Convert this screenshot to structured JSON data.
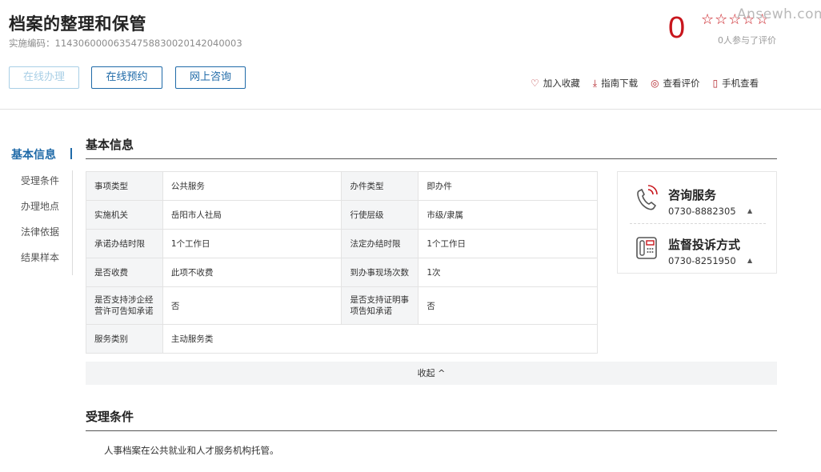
{
  "header": {
    "title": "档案的整理和保管",
    "code_label": "实施编码：",
    "code_value": "11430600006354758830020142040003",
    "buttons": [
      "在线办理",
      "在线预约",
      "网上咨询"
    ],
    "score": "0",
    "stars": "☆☆☆☆☆",
    "rating_count": "0人参与了评价",
    "watermark": "Ansewh.com",
    "actions": [
      {
        "icon": "heart-icon",
        "label": "加入收藏"
      },
      {
        "icon": "download-icon",
        "label": "指南下载"
      },
      {
        "icon": "review-icon",
        "label": "查看评价"
      },
      {
        "icon": "mobile-icon",
        "label": "手机查看"
      }
    ]
  },
  "sidenav": {
    "items": [
      "基本信息",
      "受理条件",
      "办理地点",
      "法律依据",
      "结果样本"
    ],
    "active_index": 0
  },
  "basic_info": {
    "heading": "基本信息",
    "rows": [
      [
        "事项类型",
        "公共服务",
        "办件类型",
        "即办件"
      ],
      [
        "实施机关",
        "岳阳市人社局",
        "行使层级",
        "市级/隶属"
      ],
      [
        "承诺办结时限",
        "1个工作日",
        "法定办结时限",
        "1个工作日"
      ],
      [
        "是否收费",
        "此项不收费",
        "到办事现场次数",
        "1次"
      ],
      [
        "是否支持涉企经营许可告知承诺",
        "否",
        "是否支持证明事项告知承诺",
        "否"
      ],
      [
        "服务类别",
        "主动服务类",
        "",
        ""
      ]
    ],
    "collapse_label": "收起 ^"
  },
  "contact": {
    "consult": {
      "title": "咨询服务",
      "phone": "0730-8882305",
      "icon": "phone-icon"
    },
    "complaint": {
      "title": "监督投诉方式",
      "phone": "0730-8251950",
      "icon": "telephone-icon"
    }
  },
  "conditions": {
    "heading": "受理条件",
    "text": "人事档案在公共就业和人才服务机构托管。"
  },
  "colors": {
    "brand": "#1f6aa8",
    "accent": "#c8161d"
  }
}
